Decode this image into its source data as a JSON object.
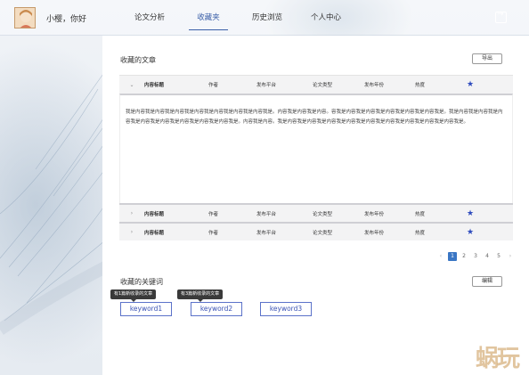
{
  "header": {
    "greeting": "小樱，你好",
    "nav": [
      {
        "label": "论文分析",
        "active": false
      },
      {
        "label": "收藏夹",
        "active": true
      },
      {
        "label": "历史浏览",
        "active": false
      },
      {
        "label": "个人中心",
        "active": false
      }
    ],
    "logout_icon": "logout-icon"
  },
  "articles": {
    "title": "收藏的文章",
    "export_label": "导出",
    "columns": [
      "内容标题",
      "作者",
      "发布平台",
      "论文类型",
      "发布年份",
      "热度"
    ],
    "rows": [
      {
        "title": "内容标题",
        "author": "作者",
        "platform": "发布平台",
        "type": "论文类型",
        "year": "发布年份",
        "heat": "热度",
        "expanded": true
      },
      {
        "title": "内容标题",
        "author": "作者",
        "platform": "发布平台",
        "type": "论文类型",
        "year": "发布年份",
        "heat": "热度",
        "expanded": false
      },
      {
        "title": "内容标题",
        "author": "作者",
        "platform": "发布平台",
        "type": "论文类型",
        "year": "发布年份",
        "heat": "热度",
        "expanded": false
      }
    ],
    "expanded_text": "我是内容我是内容我是内容我是内容我是内容我是内容我是内容我是。内容我是内容我是内容。容我是内容我是内容我是内容我是内容我是内容我是。我是内容我是内容我是内容我是内容我是内容我是内容我是内容我是内容我是。内容我是内容。我是内容我是内容我是内容我是内容我是内容我是内容我是内容我是内容我是内容我是。",
    "pagination": {
      "pages": [
        "1",
        "2",
        "3",
        "4",
        "5"
      ],
      "current": "1",
      "prev": "‹",
      "next": "›"
    }
  },
  "keywords": {
    "title": "收藏的关键词",
    "edit_label": "编辑",
    "items": [
      {
        "label": "keyword1",
        "tooltip": "有1篇新收录的文章"
      },
      {
        "label": "keyword2",
        "tooltip": "有3篇新收录的文章"
      },
      {
        "label": "keyword3",
        "tooltip": ""
      }
    ]
  },
  "watermark": "蜗玩",
  "colors": {
    "accent": "#3a5fa8",
    "star": "#2e4bbd",
    "keyword_border": "#5b72c9",
    "page_active": "#3a76c4"
  }
}
